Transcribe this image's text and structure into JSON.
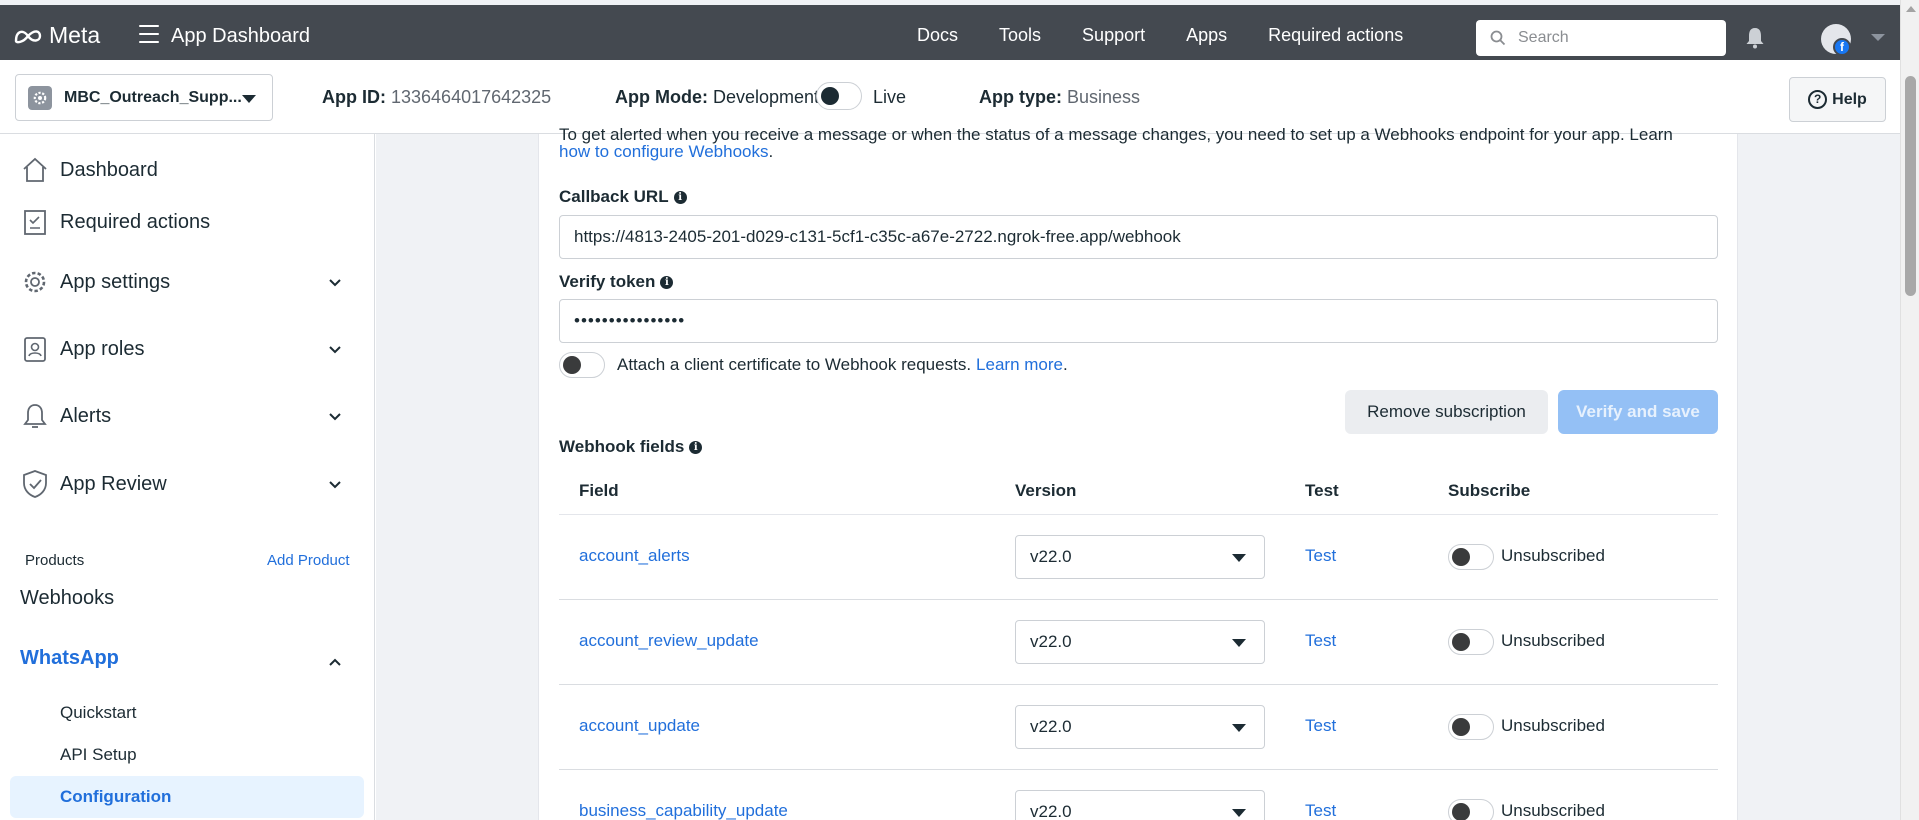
{
  "topbar": {
    "logo_text": "Meta",
    "title": "App Dashboard",
    "nav": [
      "Docs",
      "Tools",
      "Support",
      "Apps",
      "Required actions"
    ],
    "search_placeholder": "Search",
    "avatar_badge": "f"
  },
  "subheader": {
    "app_name": "MBC_Outreach_Supp...",
    "app_id_label": "App ID:",
    "app_id": "1336464017642325",
    "app_mode_label": "App Mode:",
    "app_mode_value": "Development",
    "app_mode_live": "Live",
    "app_type_label": "App type:",
    "app_type_value": "Business",
    "help_label": "Help"
  },
  "sidebar": {
    "items": [
      {
        "label": "Dashboard",
        "icon": "home-icon"
      },
      {
        "label": "Required actions",
        "icon": "clipboard-icon"
      },
      {
        "label": "App settings",
        "icon": "gear-icon"
      },
      {
        "label": "App roles",
        "icon": "id-badge-icon"
      },
      {
        "label": "Alerts",
        "icon": "bell-icon"
      },
      {
        "label": "App Review",
        "icon": "shield-check-icon"
      }
    ],
    "products_label": "Products",
    "add_product_label": "Add Product",
    "webhooks_label": "Webhooks",
    "whatsapp_label": "WhatsApp",
    "whatsapp_sub": [
      "Quickstart",
      "API Setup",
      "Configuration"
    ]
  },
  "main": {
    "clipped_intro": "To get alerted when you receive a message or when the status of a message changes, you need to set up a Webhooks endpoint for your app. Learn",
    "webhooks_link": "how to configure Webhooks",
    "period": ".",
    "callback_label": "Callback URL",
    "callback_value": "https://4813-2405-201-d029-c131-5cf1-c35c-a67e-2722.ngrok-free.app/webhook",
    "verify_label": "Verify token",
    "verify_value": "••••••••••••••••",
    "cert_text": "Attach a client certificate to Webhook requests.",
    "learn_more": "Learn more",
    "remove_button": "Remove subscription",
    "verify_button": "Verify and save",
    "webhook_fields_label": "Webhook fields",
    "columns": {
      "field": "Field",
      "version": "Version",
      "test": "Test",
      "subscribe": "Subscribe"
    },
    "rows": [
      {
        "field": "account_alerts",
        "version": "v22.0",
        "test": "Test",
        "status": "Unsubscribed"
      },
      {
        "field": "account_review_update",
        "version": "v22.0",
        "test": "Test",
        "status": "Unsubscribed"
      },
      {
        "field": "account_update",
        "version": "v22.0",
        "test": "Test",
        "status": "Unsubscribed"
      },
      {
        "field": "business_capability_update",
        "version": "v22.0",
        "test": "Test",
        "status": "Unsubscribed"
      }
    ]
  },
  "colors": {
    "topbar": "#444950",
    "link": "#216fdb",
    "primary_disabled": "#94c0f5",
    "main_bg": "#f0f2f5"
  }
}
